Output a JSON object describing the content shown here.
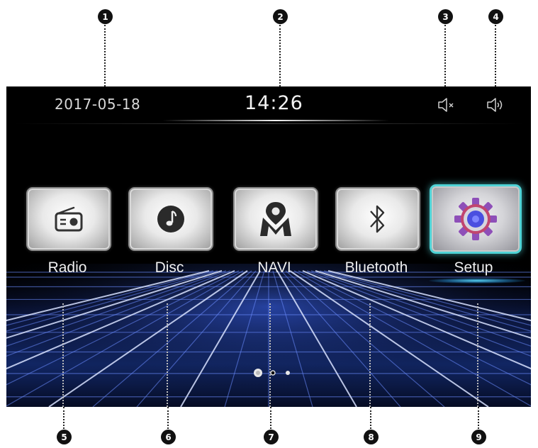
{
  "callouts": [
    "1",
    "2",
    "3",
    "4",
    "5",
    "6",
    "7",
    "8",
    "9"
  ],
  "status": {
    "date": "2017-05-18",
    "time": "14:26",
    "mute_icon": "mute-icon",
    "volume_icon": "volume-icon"
  },
  "apps": [
    {
      "label": "Radio",
      "icon": "radio-icon"
    },
    {
      "label": "Disc",
      "icon": "disc-icon"
    },
    {
      "label": "NAVI",
      "icon": "navigation-icon"
    },
    {
      "label": "Bluetooth",
      "icon": "bluetooth-icon"
    },
    {
      "label": "Setup",
      "icon": "gear-icon",
      "selected": true
    }
  ],
  "pager": {
    "pages": 3,
    "current": 1
  },
  "colors": {
    "background": "#000000",
    "accent": "#4fd3d6",
    "grid": "#6b8cff",
    "gear_purple": "#8e4fb8",
    "gear_center": "#4a4fe0"
  }
}
